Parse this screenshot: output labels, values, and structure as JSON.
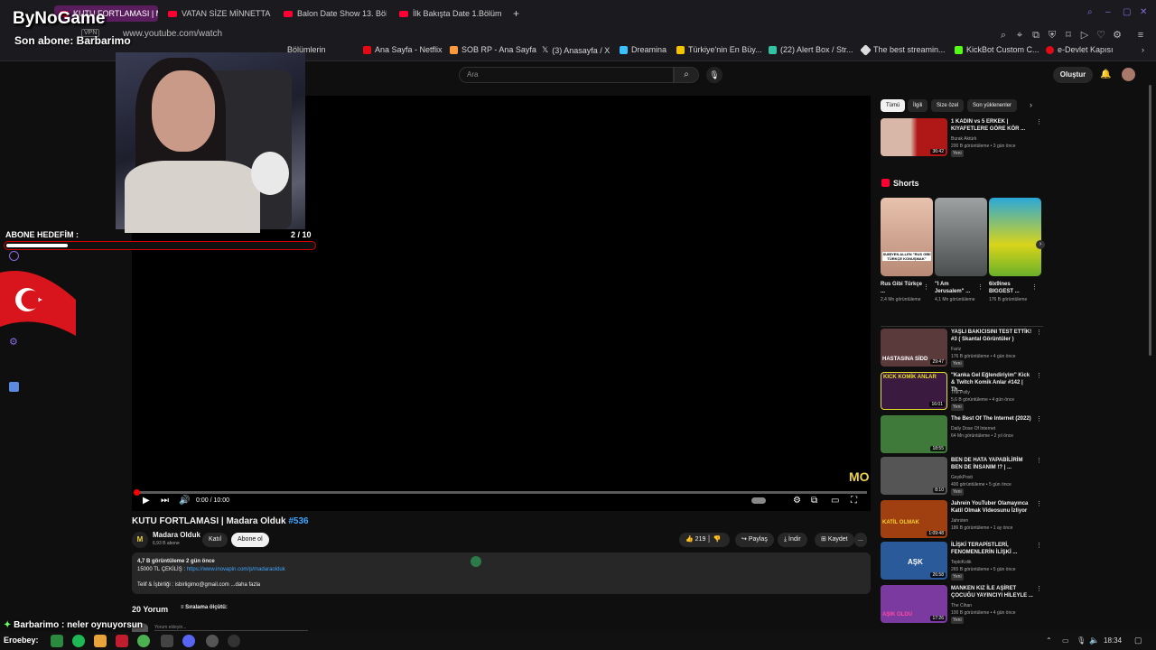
{
  "browser": {
    "tabs": [
      {
        "label": "KUTU FORTLAMASI | Ma",
        "active": true
      },
      {
        "label": "VATAN SİZE MİNNETTAR"
      },
      {
        "label": "Balon Date Show 13. Bölü"
      },
      {
        "label": "İlk Bakışta Date 1.Bölüm -"
      }
    ],
    "new_tab": "+",
    "vpn_label": "VPN",
    "url": "www.youtube.com/watch",
    "bookmarks": [
      {
        "label": "Ana Sayfa - Netflix",
        "color": "#e50914"
      },
      {
        "label": "SOB RP - Ana Sayfa",
        "color": "#ff9a3c"
      },
      {
        "label": "(3) Anasayfa / X",
        "color": "#ffffff"
      },
      {
        "label": "Dreamina",
        "color": "#39c0ff"
      },
      {
        "label": "Türkiye'nin En Büy...",
        "color": "#f5c400"
      },
      {
        "label": "(22) Alert Box / Str...",
        "color": "#31c3a2"
      },
      {
        "label": "The best streamin...",
        "color": "#dddddd"
      },
      {
        "label": "KickBot Custom C...",
        "color": "#53fc18"
      },
      {
        "label": "e-Devlet Kapısı",
        "color": "#e30a17"
      }
    ],
    "bookmark_partial": "Bölümlerin"
  },
  "youtube": {
    "search_placeholder": "Ara",
    "create_label": "Oluştur",
    "player": {
      "time": "0:00 / 10:00",
      "watermark": "MO"
    },
    "video": {
      "title": "KUTU FORTLAMASI | Madara Olduk",
      "hashtag": "#536",
      "channel": "Madara Olduk",
      "subscribers": "6,93 B abone",
      "join_label": "Katıl",
      "subscribe_label": "Abone ol",
      "likes": "219",
      "share_label": "Paylaş",
      "download_label": "İndir",
      "save_label": "Kaydet",
      "more_label": "...",
      "desc_stats": "4,7 B görüntüleme  2 gün önce",
      "desc_line2_prefix": "15000 TL ÇEKİLİŞ : ",
      "desc_link": "https://www.inovapin.com/p/madaraolduk",
      "desc_line3": "Telif & İşbirliği : isbirligimo@gmail.com  ...daha fazla"
    },
    "comments": {
      "count": "20 Yorum",
      "sort_label": "Sıralama ölçütü:",
      "add_placeholder": "Yorum ekleyin..."
    },
    "filters": [
      "Tümü",
      "İlgili",
      "Size özel",
      "Son yüklenenler"
    ],
    "top_video": {
      "title": "1 KADIN vs 5 ERKEK | KIYAFETLERE GÖRE KÖR ...",
      "channel": "Burak Aktürk",
      "meta": "200 B görüntüleme • 3 gün önce",
      "badge": "Yeni",
      "duration": "36:42"
    },
    "shorts_heading": "Shorts",
    "shorts": [
      {
        "title": "Rus Gibi Türkçe ...",
        "views": "2,4 Mn görüntüleme",
        "thumb_label": "SUBİYEN ALLEN \"RUS GİBİ TÜRKÇE KONUŞMAK\"",
        "color": "#c9a08c"
      },
      {
        "title": "\"I Am Jerusalem\" ...",
        "views": "4,1 Mn görüntüleme",
        "color": "#7a7e7f"
      },
      {
        "title": "6ix9ines BIGGEST ...",
        "views": "176 B görüntüleme",
        "color": "#c9d42a"
      }
    ],
    "related": [
      {
        "title": "YAŞLI BAKICISINI TEST ETTİK! #3 ( Skantal Görüntüler )",
        "channel": "Fariz",
        "meta": "176 B görüntüleme • 4 gün önce",
        "badge": "Yeni",
        "duration": "29:47",
        "color": "#5a3a3a",
        "thumb_text": "HASTASINA SİDD"
      },
      {
        "title": "\"Kanka Gel Eğlendiriyim\" Kick & Twitch Komik Anlar #142 | Th...",
        "channel": "The Polly",
        "meta": "5,6 B görüntüleme • 4 gün önce",
        "badge": "Yeni",
        "duration": "16:01",
        "color": "#3a1a3e",
        "thumb_text": "KICK KOMİK ANLAR"
      },
      {
        "title": "The Best Of The Internet (2022)",
        "channel": "Daily Dose Of Internet",
        "meta": "64 Mn görüntüleme • 2 yıl önce",
        "duration": "18:55",
        "color": "#3f7a3a"
      },
      {
        "title": "BEN DE HATA YAPABİLİRİM BEN DE İNSANIM !? | ...",
        "channel": "GeyikPosti",
        "meta": "400 görüntüleme • 5 gün önce",
        "badge": "Yeni",
        "duration": "8:10",
        "color": "#555555"
      },
      {
        "title": "Jahrein YouTuber Olamayınca Katil Olmak Videosunu İzliyor",
        "channel": "Jahrsten",
        "meta": "186 B görüntüleme • 1 ay önce",
        "duration": "1:09:48",
        "color": "#a04010",
        "thumb_text": "KATİL OLMAK"
      },
      {
        "title": "İLİŞKİ TERAPİSTLERİ, FENOMENLERİN İLİŞKİ ...",
        "channel": "TepkiKolik",
        "meta": "265 B görüntüleme • 5 gün önce",
        "badge": "Yeni",
        "duration": "26:58",
        "color": "#2a5a9a",
        "thumb_text": "AŞK"
      },
      {
        "title": "MANKEN KIZ İLE AŞİRET ÇOCUĞU YAYINCIYI HİLEYLE ...",
        "channel": "The Cihan",
        "meta": "100 B görüntüleme • 4 gün önce",
        "badge": "Yeni",
        "duration": "17:26",
        "color": "#7a3aa0",
        "thumb_text": "AŞIK OLDU"
      }
    ]
  },
  "stream_overlay": {
    "channel_name": "ByNoGame",
    "last_sub_text": "Son abone: Barbarimo",
    "goal_label": "ABONE HEDEFİM :",
    "goal_count": "2  / 10",
    "goal_progress": 0.2,
    "chat_user": "Barbarimo",
    "chat_message": " : neler oynuyorsun",
    "chat_user_2": "Eroebey:"
  },
  "taskbar": {
    "time": "18:34"
  },
  "colors": {
    "accent_red": "#ff0033",
    "link_blue": "#3ea6ff",
    "active_tab": "#5a1e5e"
  }
}
